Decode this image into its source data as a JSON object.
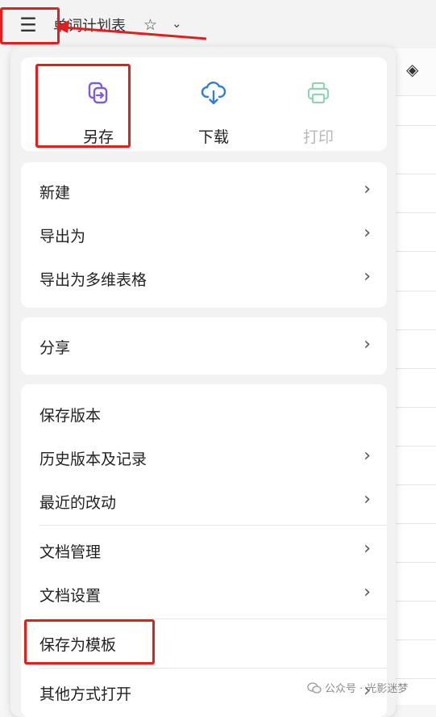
{
  "topbar": {
    "menu_icon": "menu-icon",
    "doc_title": "单词计划表",
    "star_icon": "star-icon",
    "chevron_icon": "chevron-down-icon"
  },
  "toolbar_right": {
    "fill_icon": "paint-bucket-icon"
  },
  "menu": {
    "actions": [
      {
        "label": "另存",
        "icon": "save-as-icon",
        "color": "#7b5cd6"
      },
      {
        "label": "下载",
        "icon": "cloud-download-icon",
        "color": "#2f7ed8"
      },
      {
        "label": "打印",
        "icon": "printer-icon",
        "color": "#8fd5b3",
        "disabled": true
      }
    ],
    "group1": [
      {
        "label": "新建"
      },
      {
        "label": "导出为"
      },
      {
        "label": "导出为多维表格"
      }
    ],
    "group2": [
      {
        "label": "分享"
      }
    ],
    "group3": [
      {
        "label": "保存版本"
      },
      {
        "label": "历史版本及记录"
      },
      {
        "label": "最近的改动"
      },
      {
        "label": "文档管理"
      },
      {
        "label": "文档设置"
      },
      {
        "label": "保存为模板"
      },
      {
        "label": "其他方式打开"
      }
    ],
    "arrow": "›"
  },
  "watermark": {
    "text": "公众号 · 光影迷梦"
  },
  "annotation_color": "#e02020"
}
